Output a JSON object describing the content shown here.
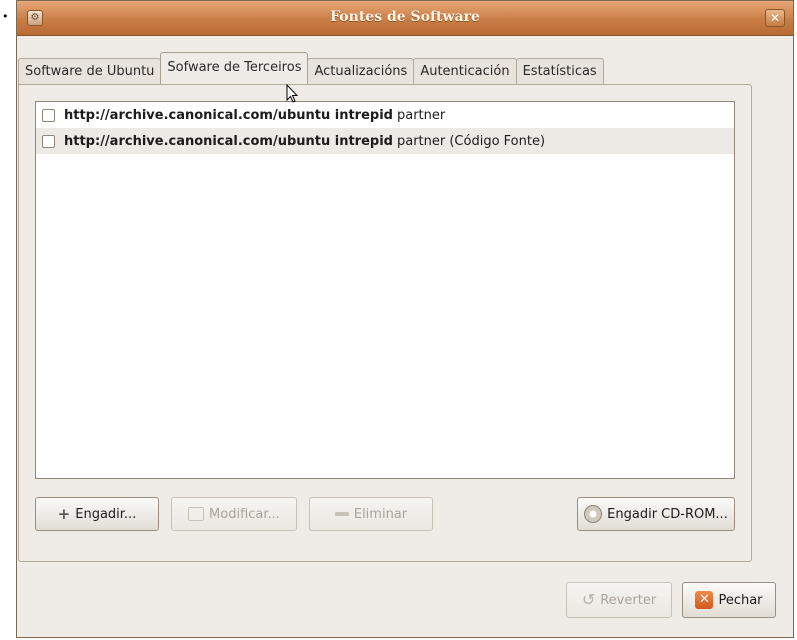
{
  "window": {
    "title": "Fontes de Software"
  },
  "tabs": [
    {
      "label": "Software de Ubuntu",
      "active": false
    },
    {
      "label": "Sofware de Terceiros",
      "active": true
    },
    {
      "label": "Actualizacións",
      "active": false
    },
    {
      "label": "Autenticación",
      "active": false
    },
    {
      "label": "Estatísticas",
      "active": false
    }
  ],
  "sources": [
    {
      "uri": "http://archive.canonical.com/ubuntu intrepid",
      "component": "partner",
      "checked": false
    },
    {
      "uri": "http://archive.canonical.com/ubuntu intrepid",
      "component": "partner (Código Fonte)",
      "checked": false
    }
  ],
  "buttons": {
    "add": "Engadir...",
    "edit": "Modificar...",
    "remove": "Eliminar",
    "add_cdrom": "Engadir CD-ROM...",
    "revert": "Reverter",
    "close": "Pechar"
  },
  "icons": {
    "window": "software-properties-icon",
    "close": "close-icon",
    "add": "plus-icon",
    "edit": "edit-icon",
    "remove": "remove-icon",
    "cdrom": "cdrom-icon",
    "revert": "revert-icon",
    "close_button": "close-icon"
  }
}
